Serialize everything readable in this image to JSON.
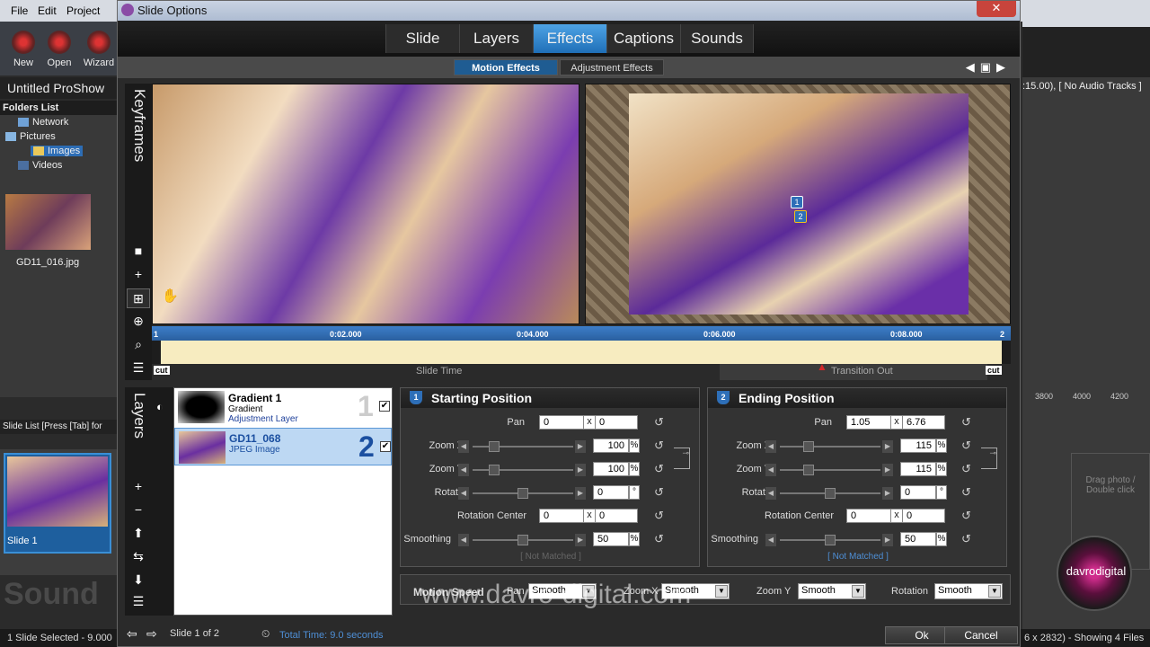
{
  "bg_app": {
    "menu": [
      "File",
      "Edit",
      "Project"
    ],
    "toolbar": [
      {
        "label": "New"
      },
      {
        "label": "Open"
      },
      {
        "label": "Wizard"
      }
    ],
    "title": "Untitled ProShow",
    "folders_header": "Folders List",
    "folders": [
      "Network",
      "Pictures",
      "Images",
      "Videos"
    ],
    "thumb_label": "GD11_016.jpg",
    "slide_list_header": "Slide List [Press [Tab] for",
    "slide_label": "Slide 1",
    "sound_label": "Sound",
    "right_info": ":15.00), [ No Audio Tracks ]",
    "ruler": [
      "3800",
      "4000",
      "4200"
    ],
    "drop_text": [
      "Drag photo /",
      "Double click"
    ],
    "status_left": "1 Slide Selected - 9.000",
    "status_right": "6 x 2832) - Showing 4 Files",
    "logo_text": "davrodigital"
  },
  "dialog": {
    "title": "Slide Options",
    "close": "✕",
    "tabs": [
      "Slide",
      "Layers",
      "Effects",
      "Captions",
      "Sounds"
    ],
    "active_tab": "Effects",
    "subtabs": [
      "Motion Effects",
      "Adjustment Effects"
    ],
    "keyframes_label": "Keyframes",
    "layers_label": "Layers",
    "timeline": {
      "ticks": [
        "0:02.000",
        "0:04.000",
        "0:06.000",
        "0:08.000"
      ],
      "start_marker": "1",
      "end_marker": "2",
      "slide_time": "Slide Time",
      "transition_out": "Transition Out",
      "cut_left": "cut",
      "cut_right": "cut"
    },
    "layers": [
      {
        "name": "Gradient 1",
        "type": "Gradient",
        "sub": "Adjustment Layer",
        "num": "1",
        "checked": true
      },
      {
        "name": "GD11_068",
        "type": "JPEG Image",
        "sub": "",
        "num": "2",
        "checked": true
      }
    ],
    "markers": [
      "1",
      "2"
    ],
    "starting": {
      "header": "Starting Position",
      "badge": "1",
      "pan_label": "Pan",
      "pan_x": "0",
      "pan_y": "0",
      "zoomx_label": "Zoom X",
      "zoomx": "100",
      "zoomy_label": "Zoom Y",
      "zoomy": "100",
      "rotate_label": "Rotate",
      "rotate": "0",
      "rc_label": "Rotation Center",
      "rc_x": "0",
      "rc_y": "0",
      "smoothing_label": "Smoothing",
      "smoothing": "50",
      "note": "[ Not Matched ]"
    },
    "ending": {
      "header": "Ending Position",
      "badge": "2",
      "pan_label": "Pan",
      "pan_x": "1.05",
      "pan_y": "6.76",
      "zoomx_label": "Zoom X",
      "zoomx": "115",
      "zoomy_label": "Zoom Y",
      "zoomy": "115",
      "rotate_label": "Rotate",
      "rotate": "0",
      "rc_label": "Rotation Center",
      "rc_x": "0",
      "rc_y": "0",
      "smoothing_label": "Smoothing",
      "smoothing": "50",
      "note": "[ Not Matched ]"
    },
    "units": {
      "x": "x",
      "pct": "%",
      "deg": "°"
    },
    "motion_speed": {
      "label": "Motion Speed",
      "pan_label": "Pan",
      "pan": "Smooth",
      "zoomx_label": "Zoom X",
      "zoomx": "Smooth",
      "zoomy_label": "Zoom Y",
      "zoomy": "Smooth",
      "rotation_label": "Rotation",
      "rotation": "Smooth"
    },
    "watermark": "www.davro-digital.com",
    "footer": {
      "slide_of": "Slide 1 of 2",
      "total_time": "Total Time: 9.0 seconds",
      "ok": "Ok",
      "cancel": "Cancel"
    }
  },
  "colors": {
    "accent": "#2e79c7",
    "tab_active": "#3a8fd6",
    "timeline_track": "#f7ecc0"
  }
}
